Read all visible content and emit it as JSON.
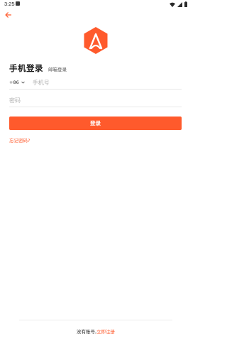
{
  "status_bar": {
    "time": "3:25"
  },
  "header": {
    "back_icon": "arrow-left-icon",
    "accent_color": "#ff5a2c"
  },
  "logo": {
    "icon": "hexagon-a-logo",
    "color": "#ff5a2c"
  },
  "login": {
    "title": "手机登录",
    "email_tab": "邮箱登录",
    "country_code": "+86",
    "phone_placeholder": "手机号",
    "password_placeholder": "密码",
    "submit_label": "登录",
    "forgot_password": "忘记密码?"
  },
  "footer": {
    "no_account_text": "没有账号,",
    "register_label": "立即注册"
  }
}
